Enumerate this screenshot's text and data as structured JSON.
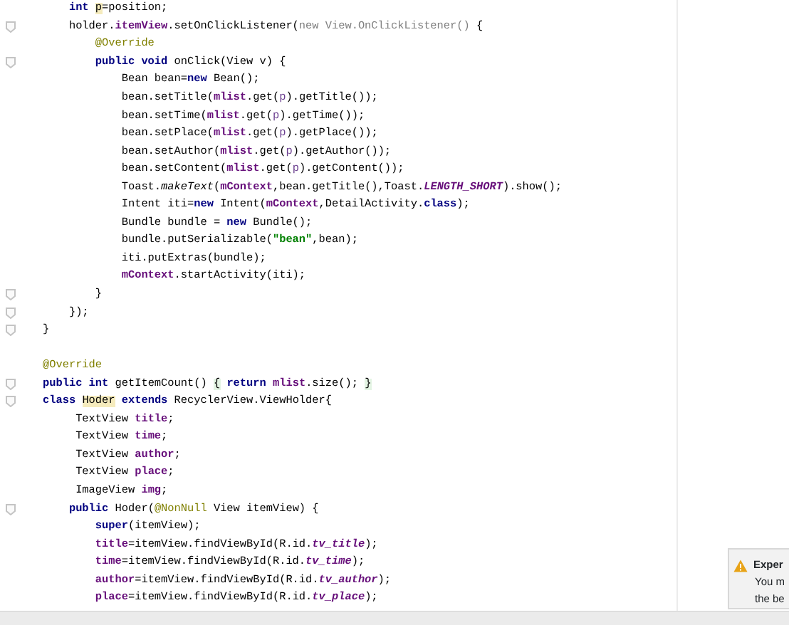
{
  "editor": {
    "lines": [
      {
        "kind": "code",
        "fold_marker": false,
        "tokens": [
          {
            "kind": "kw",
            "text": "    int "
          },
          {
            "kind": "hl",
            "text": "p"
          },
          {
            "kind": "pl",
            "text": "=position;"
          }
        ]
      },
      {
        "kind": "code",
        "fold_marker": true,
        "tokens": [
          {
            "kind": "pl",
            "text": "    holder."
          },
          {
            "kind": "fd",
            "text": "itemView"
          },
          {
            "kind": "pl",
            "text": ".setOnClickListener("
          },
          {
            "kind": "mu",
            "text": "new View.OnClickListener() "
          },
          {
            "kind": "pl",
            "text": "{"
          }
        ]
      },
      {
        "kind": "code",
        "fold_marker": false,
        "tokens": [
          {
            "kind": "an",
            "text": "        @Override"
          }
        ]
      },
      {
        "kind": "code",
        "fold_marker": true,
        "tokens": [
          {
            "kind": "kw",
            "text": "        public void"
          },
          {
            "kind": "pl",
            "text": " onClick(View v) {"
          }
        ]
      },
      {
        "kind": "code",
        "fold_marker": false,
        "tokens": [
          {
            "kind": "pl",
            "text": "            Bean bean="
          },
          {
            "kind": "kw",
            "text": "new"
          },
          {
            "kind": "pl",
            "text": " Bean();"
          }
        ]
      },
      {
        "kind": "code",
        "fold_marker": false,
        "tokens": [
          {
            "kind": "pl",
            "text": "            bean.setTitle("
          },
          {
            "kind": "fd",
            "text": "mlist"
          },
          {
            "kind": "pl",
            "text": ".get("
          },
          {
            "kind": "pr",
            "text": "p"
          },
          {
            "kind": "pl",
            "text": ").getTitle());"
          }
        ]
      },
      {
        "kind": "code",
        "fold_marker": false,
        "tokens": [
          {
            "kind": "pl",
            "text": "            bean.setTime("
          },
          {
            "kind": "fd",
            "text": "mlist"
          },
          {
            "kind": "pl",
            "text": ".get("
          },
          {
            "kind": "pr",
            "text": "p"
          },
          {
            "kind": "pl",
            "text": ").getTime());"
          }
        ]
      },
      {
        "kind": "code",
        "fold_marker": false,
        "tokens": [
          {
            "kind": "pl",
            "text": "            bean.setPlace("
          },
          {
            "kind": "fd",
            "text": "mlist"
          },
          {
            "kind": "pl",
            "text": ".get("
          },
          {
            "kind": "pr",
            "text": "p"
          },
          {
            "kind": "pl",
            "text": ").getPlace());"
          }
        ]
      },
      {
        "kind": "code",
        "fold_marker": false,
        "tokens": [
          {
            "kind": "pl",
            "text": "            bean.setAuthor("
          },
          {
            "kind": "fd",
            "text": "mlist"
          },
          {
            "kind": "pl",
            "text": ".get("
          },
          {
            "kind": "pr",
            "text": "p"
          },
          {
            "kind": "pl",
            "text": ").getAuthor());"
          }
        ]
      },
      {
        "kind": "code",
        "fold_marker": false,
        "tokens": [
          {
            "kind": "pl",
            "text": "            bean.setContent("
          },
          {
            "kind": "fd",
            "text": "mlist"
          },
          {
            "kind": "pl",
            "text": ".get("
          },
          {
            "kind": "pr",
            "text": "p"
          },
          {
            "kind": "pl",
            "text": ").getContent());"
          }
        ]
      },
      {
        "kind": "code",
        "fold_marker": false,
        "tokens": [
          {
            "kind": "pl",
            "text": "            Toast."
          },
          {
            "kind": "it",
            "text": "makeText"
          },
          {
            "kind": "pl",
            "text": "("
          },
          {
            "kind": "fd",
            "text": "mContext"
          },
          {
            "kind": "pl",
            "text": ",bean.getTitle(),Toast."
          },
          {
            "kind": "sc",
            "text": "LENGTH_SHORT"
          },
          {
            "kind": "pl",
            "text": ").show();"
          }
        ]
      },
      {
        "kind": "code",
        "fold_marker": false,
        "tokens": [
          {
            "kind": "pl",
            "text": "            Intent iti="
          },
          {
            "kind": "kw",
            "text": "new"
          },
          {
            "kind": "pl",
            "text": " Intent("
          },
          {
            "kind": "fd",
            "text": "mContext"
          },
          {
            "kind": "pl",
            "text": ",DetailActivity."
          },
          {
            "kind": "kw",
            "text": "class"
          },
          {
            "kind": "pl",
            "text": ");"
          }
        ]
      },
      {
        "kind": "code",
        "fold_marker": false,
        "tokens": [
          {
            "kind": "pl",
            "text": "            Bundle bundle = "
          },
          {
            "kind": "kw",
            "text": "new"
          },
          {
            "kind": "pl",
            "text": " Bundle();"
          }
        ]
      },
      {
        "kind": "code",
        "fold_marker": false,
        "tokens": [
          {
            "kind": "pl",
            "text": "            bundle.putSerializable("
          },
          {
            "kind": "st",
            "text": "\"bean\""
          },
          {
            "kind": "pl",
            "text": ",bean);"
          }
        ]
      },
      {
        "kind": "code",
        "fold_marker": false,
        "tokens": [
          {
            "kind": "pl",
            "text": "            iti.putExtras(bundle);"
          }
        ]
      },
      {
        "kind": "code",
        "fold_marker": false,
        "tokens": [
          {
            "kind": "fd",
            "text": "            mContext"
          },
          {
            "kind": "pl",
            "text": ".startActivity(iti);"
          }
        ]
      },
      {
        "kind": "code",
        "fold_marker": true,
        "tokens": [
          {
            "kind": "pl",
            "text": "        }"
          }
        ]
      },
      {
        "kind": "code",
        "fold_marker": true,
        "tokens": [
          {
            "kind": "pl",
            "text": "    });"
          }
        ]
      },
      {
        "kind": "code",
        "fold_marker": true,
        "tokens": [
          {
            "kind": "pl",
            "text": "}"
          }
        ]
      },
      {
        "kind": "code",
        "fold_marker": false,
        "blank_line_before": true,
        "tokens": [
          {
            "kind": "an",
            "text": "@Override"
          }
        ]
      },
      {
        "kind": "code",
        "fold_marker": true,
        "tokens": [
          {
            "kind": "kw",
            "text": "public int"
          },
          {
            "kind": "pl",
            "text": " getItemCount() "
          },
          {
            "kind": "fo",
            "text": "{"
          },
          {
            "kind": "kw",
            "text": " return"
          },
          {
            "kind": "fd",
            "text": " mlist"
          },
          {
            "kind": "pl",
            "text": ".size(); "
          },
          {
            "kind": "fo",
            "text": "}"
          }
        ]
      },
      {
        "kind": "code",
        "fold_marker": true,
        "tokens": [
          {
            "kind": "kw",
            "text": "class "
          },
          {
            "kind": "hl",
            "text": "Hoder"
          },
          {
            "kind": "kw",
            "text": " extends"
          },
          {
            "kind": "pl",
            "text": " RecyclerView.ViewHolder{"
          }
        ]
      },
      {
        "kind": "code",
        "fold_marker": false,
        "tokens": [
          {
            "kind": "pl",
            "text": "     TextView "
          },
          {
            "kind": "fd",
            "text": "title"
          },
          {
            "kind": "pl",
            "text": ";"
          }
        ]
      },
      {
        "kind": "code",
        "fold_marker": false,
        "tokens": [
          {
            "kind": "pl",
            "text": "     TextView "
          },
          {
            "kind": "fd",
            "text": "time"
          },
          {
            "kind": "pl",
            "text": ";"
          }
        ]
      },
      {
        "kind": "code",
        "fold_marker": false,
        "tokens": [
          {
            "kind": "pl",
            "text": "     TextView "
          },
          {
            "kind": "fd",
            "text": "author"
          },
          {
            "kind": "pl",
            "text": ";"
          }
        ]
      },
      {
        "kind": "code",
        "fold_marker": false,
        "tokens": [
          {
            "kind": "pl",
            "text": "     TextView "
          },
          {
            "kind": "fd",
            "text": "place"
          },
          {
            "kind": "pl",
            "text": ";"
          }
        ]
      },
      {
        "kind": "code",
        "fold_marker": false,
        "tokens": [
          {
            "kind": "pl",
            "text": "     ImageView "
          },
          {
            "kind": "fd",
            "text": "img"
          },
          {
            "kind": "pl",
            "text": ";"
          }
        ]
      },
      {
        "kind": "code",
        "fold_marker": true,
        "tokens": [
          {
            "kind": "kw",
            "text": "    public"
          },
          {
            "kind": "pl",
            "text": " Hoder("
          },
          {
            "kind": "an",
            "text": "@NonNull"
          },
          {
            "kind": "pl",
            "text": " View itemView) {"
          }
        ]
      },
      {
        "kind": "code",
        "fold_marker": false,
        "tokens": [
          {
            "kind": "kw",
            "text": "        super"
          },
          {
            "kind": "pl",
            "text": "(itemView);"
          }
        ]
      },
      {
        "kind": "code",
        "fold_marker": false,
        "tokens": [
          {
            "kind": "fd",
            "text": "        title"
          },
          {
            "kind": "pl",
            "text": "=itemView.findViewById(R.id."
          },
          {
            "kind": "cn",
            "text": "tv_title"
          },
          {
            "kind": "pl",
            "text": ");"
          }
        ]
      },
      {
        "kind": "code",
        "fold_marker": false,
        "tokens": [
          {
            "kind": "fd",
            "text": "        time"
          },
          {
            "kind": "pl",
            "text": "=itemView.findViewById(R.id."
          },
          {
            "kind": "cn",
            "text": "tv_time"
          },
          {
            "kind": "pl",
            "text": ");"
          }
        ]
      },
      {
        "kind": "code",
        "fold_marker": false,
        "tokens": [
          {
            "kind": "fd",
            "text": "        author"
          },
          {
            "kind": "pl",
            "text": "=itemView.findViewById(R.id."
          },
          {
            "kind": "cn",
            "text": "tv_author"
          },
          {
            "kind": "pl",
            "text": ");"
          }
        ]
      },
      {
        "kind": "code",
        "fold_marker": false,
        "tokens": [
          {
            "kind": "fd",
            "text": "        place"
          },
          {
            "kind": "pl",
            "text": "=itemView.findViewById(R.id."
          },
          {
            "kind": "cn",
            "text": "tv_place"
          },
          {
            "kind": "pl",
            "text": ");"
          }
        ]
      }
    ]
  },
  "notification": {
    "kind": "warning",
    "title": "Exper",
    "body_lines": [
      "You m",
      "the be"
    ]
  }
}
